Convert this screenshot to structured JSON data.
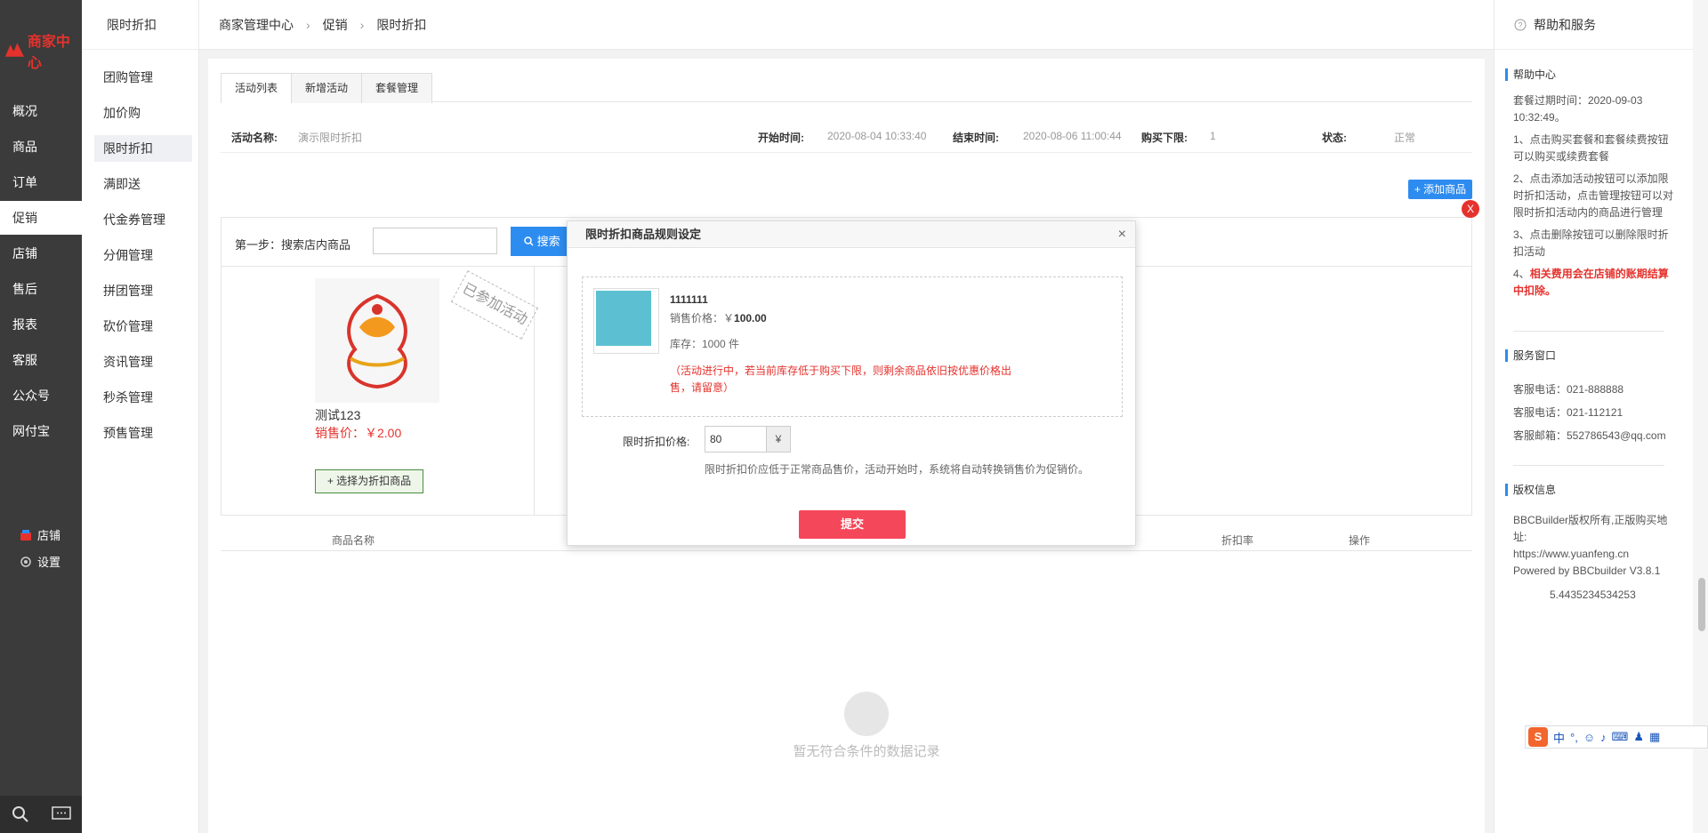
{
  "sidebar": {
    "logo_text": "商家中心",
    "items": [
      {
        "label": "概况"
      },
      {
        "label": "商品"
      },
      {
        "label": "订单"
      },
      {
        "label": "促销"
      },
      {
        "label": "店铺"
      },
      {
        "label": "售后"
      },
      {
        "label": "报表"
      },
      {
        "label": "客服"
      },
      {
        "label": "公众号"
      },
      {
        "label": "网付宝"
      }
    ],
    "active_index": 3,
    "bottom_links": [
      {
        "label": "店铺"
      },
      {
        "label": "设置"
      }
    ]
  },
  "subnav": {
    "title": "限时折扣",
    "items": [
      {
        "label": "团购管理"
      },
      {
        "label": "加价购"
      },
      {
        "label": "限时折扣"
      },
      {
        "label": "满即送"
      },
      {
        "label": "代金券管理"
      },
      {
        "label": "分佣管理"
      },
      {
        "label": "拼团管理"
      },
      {
        "label": "砍价管理"
      },
      {
        "label": "资讯管理"
      },
      {
        "label": "秒杀管理"
      },
      {
        "label": "预售管理"
      }
    ],
    "active_index": 2
  },
  "breadcrumb": [
    "商家管理中心",
    "促销",
    "限时折扣"
  ],
  "tabs": [
    "活动列表",
    "新增活动",
    "套餐管理"
  ],
  "activity": {
    "name_label": "活动名称:",
    "name_value": "演示限时折扣",
    "start_label": "开始时间:",
    "start_value": "2020-08-04 10:33:40",
    "end_label": "结束时间:",
    "end_value": "2020-08-06 11:00:44",
    "limit_label": "购买下限:",
    "limit_value": "1",
    "status_label": "状态:",
    "status_value": "正常"
  },
  "add_goods_button": "+ 添加商品",
  "close_badge": "X",
  "step": {
    "label": "第一步：搜索店内商品",
    "search_button": "搜索"
  },
  "goods_card": {
    "name": "测试123",
    "price": "销售价：￥2.00",
    "choose_button": "+ 选择为折扣商品",
    "joined_stamp": "已参加活动"
  },
  "table_headers": [
    "商品名称",
    "折扣率",
    "操作"
  ],
  "empty_text": "暂无符合条件的数据记录",
  "modal": {
    "title": "限时折扣商品规则设定",
    "close": "×",
    "product_name": "1111111",
    "sale_price_label": "销售价格：￥",
    "sale_price_value": "100.00",
    "stock": "库存：1000 件",
    "warning": "（活动进行中，若当前库存低于购买下限，则剩余商品依旧按优惠价格出售，请留意）",
    "price_label": "限时折扣价格:",
    "price_value": "80",
    "price_unit": "¥",
    "price_tip": "限时折扣价应低于正常商品售价，活动开始时，系统将自动转换销售价为促销价。",
    "submit": "提交"
  },
  "help": {
    "header": "帮助和服务",
    "help_center_title": "帮助中心",
    "help_lines": [
      "套餐过期时间：2020-09-03 10:32:49。",
      "1、点击购买套餐和套餐续费按钮可以购买或续费套餐",
      "2、点击添加活动按钮可以添加限时折扣活动，点击管理按钮可以对限时折扣活动内的商品进行管理",
      "3、点击删除按钮可以删除限时折扣活动"
    ],
    "help_line_4_prefix": "4、",
    "help_line_4_red": "相关费用会在店铺的账期结算中扣除。",
    "service_title": "服务窗口",
    "service_lines": [
      "客服电话：021-888888",
      "客服电话：021-112121",
      "客服邮箱：552786543@qq.com"
    ],
    "copyright_title": "版权信息",
    "copyright_lines": [
      "BBCBuilder版权所有,正版购买地址:",
      "https://www.yuanfeng.cn",
      "Powered by BBCbuilder V3.8.1"
    ],
    "version_number": "5.4435234534253"
  },
  "ime": {
    "logo": "S",
    "mode": "中"
  }
}
